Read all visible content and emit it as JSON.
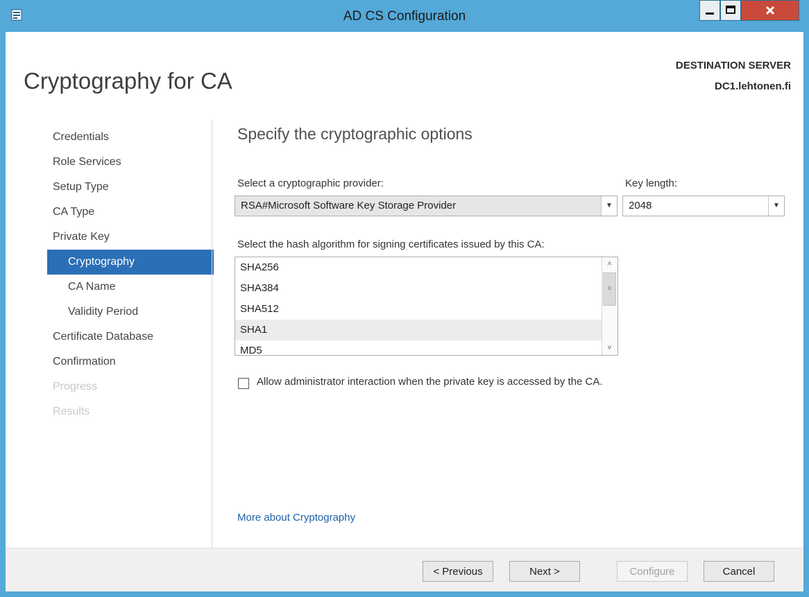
{
  "window": {
    "title": "AD CS Configuration"
  },
  "header": {
    "page_title": "Cryptography for CA",
    "destination_label": "DESTINATION SERVER",
    "destination_value": "DC1.lehtonen.fi"
  },
  "nav": {
    "items": [
      {
        "label": "Credentials",
        "state": "normal"
      },
      {
        "label": "Role Services",
        "state": "normal"
      },
      {
        "label": "Setup Type",
        "state": "normal"
      },
      {
        "label": "CA Type",
        "state": "normal"
      },
      {
        "label": "Private Key",
        "state": "normal"
      },
      {
        "label": "Cryptography",
        "state": "active"
      },
      {
        "label": "CA Name",
        "state": "sub"
      },
      {
        "label": "Validity Period",
        "state": "sub"
      },
      {
        "label": "Certificate Database",
        "state": "normal"
      },
      {
        "label": "Confirmation",
        "state": "normal"
      },
      {
        "label": "Progress",
        "state": "disabled"
      },
      {
        "label": "Results",
        "state": "disabled"
      }
    ]
  },
  "main": {
    "heading": "Specify the cryptographic options",
    "provider_label": "Select a cryptographic provider:",
    "provider_value": "RSA#Microsoft Software Key Storage Provider",
    "key_length_label": "Key length:",
    "key_length_value": "2048",
    "hash_label": "Select the hash algorithm for signing certificates issued by this CA:",
    "hash_options": [
      "SHA256",
      "SHA384",
      "SHA512",
      "SHA1",
      "MD5"
    ],
    "hash_selected": "SHA1",
    "checkbox_label": "Allow administrator interaction when the private key is accessed by the CA.",
    "checkbox_checked": false,
    "more_link": "More about Cryptography"
  },
  "footer": {
    "previous": "< Previous",
    "next": "Next >",
    "configure": "Configure",
    "cancel": "Cancel"
  },
  "colors": {
    "titlebar": "#54a9d9",
    "nav_active": "#2b6fb6",
    "link": "#1f5fa8",
    "close_button": "#c94a3b"
  },
  "icons": {
    "app": "server-manager-icon",
    "minimize": "minimize-icon",
    "maximize": "maximize-icon",
    "close": "close-icon"
  }
}
